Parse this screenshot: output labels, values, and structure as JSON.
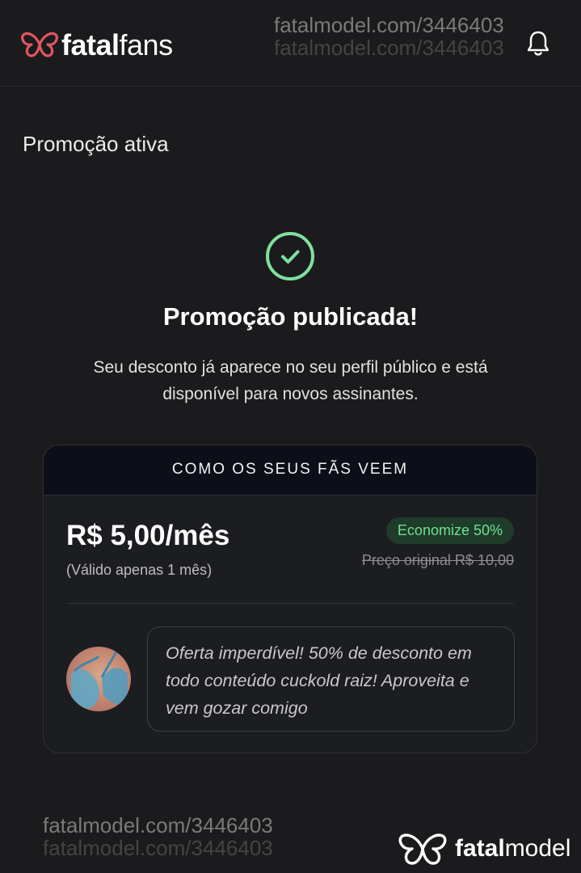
{
  "header": {
    "logo_bold": "fatal",
    "logo_light": "fans",
    "watermark": "fatalmodel.com/3446403"
  },
  "page": {
    "title": "Promoção ativa",
    "headline": "Promoção publicada!",
    "description": "Seu desconto já aparece no seu perfil público e está disponível para novos assinantes."
  },
  "preview_card": {
    "heading": "COMO OS SEUS FÃS VEEM",
    "price": "R$ 5,00/mês",
    "validity": "(Válido apenas 1 mês)",
    "discount_badge": "Economize 50%",
    "original_price": "Preço original R$ 10,00",
    "message": "Oferta imperdível! 50% de desconto em todo conteúdo cuckold raiz! Aproveita e vem gozar comigo"
  },
  "footer": {
    "watermark": "fatalmodel.com/3446403",
    "brand_bold": "fatal",
    "brand_light": "model"
  },
  "icons": {
    "logo": "butterfly-icon",
    "notification": "bell-icon",
    "success": "check-circle-icon"
  },
  "colors": {
    "background": "#1b1b1d",
    "brand_red": "#e0575f",
    "success_green": "#7ee0a0",
    "badge_bg": "#1f3b29",
    "badge_text": "#6fe08f"
  }
}
